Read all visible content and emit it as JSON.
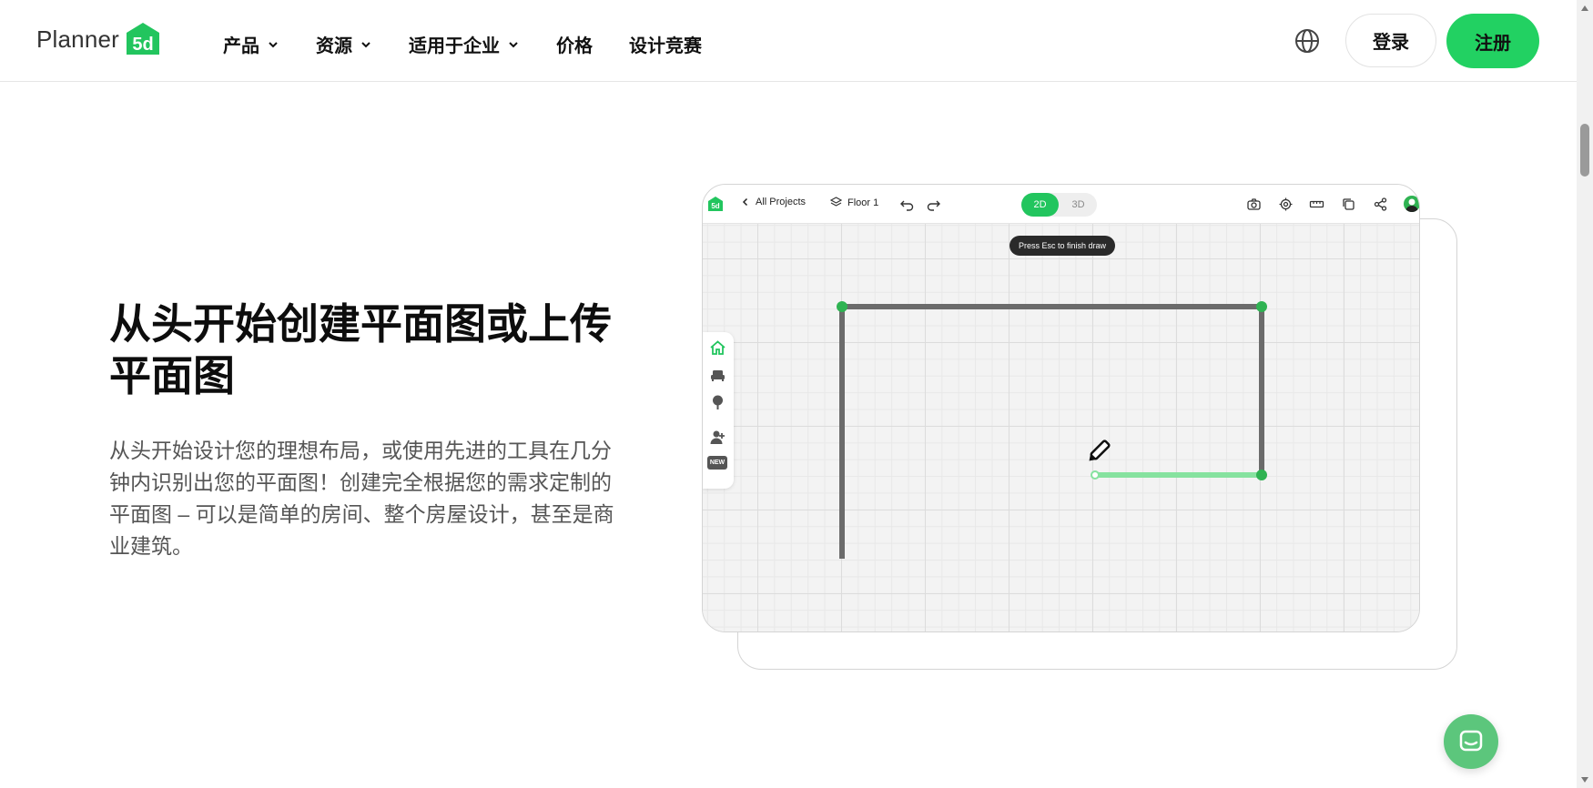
{
  "header": {
    "logo_text": "Planner",
    "logo_badge": "5d",
    "nav": [
      {
        "label": "产品",
        "has_dropdown": true
      },
      {
        "label": "资源",
        "has_dropdown": true
      },
      {
        "label": "适用于企业",
        "has_dropdown": true
      },
      {
        "label": "价格",
        "has_dropdown": false
      },
      {
        "label": "设计竞赛",
        "has_dropdown": false
      }
    ],
    "login_label": "登录",
    "register_label": "注册"
  },
  "hero": {
    "headline_line1": "从头开始创建平面图或上传",
    "headline_line2": "平面图",
    "description": "从头开始设计您的理想布局，或使用先进的工具在几分钟内识别出您的平面图！创建完全根据您的需求定制的平面图 – 可以是简单的房间、整个房屋设计，甚至是商业建筑。"
  },
  "mockup": {
    "all_projects": "All Projects",
    "floor": "Floor 1",
    "view_2d": "2D",
    "view_3d": "3D",
    "tooltip": "Press Esc to finish draw",
    "side_new_badge": "NEW"
  },
  "colors": {
    "accent": "#22d162",
    "wall": "#6b6b6b",
    "node": "#2fb352",
    "drawing": "#86e29f"
  }
}
